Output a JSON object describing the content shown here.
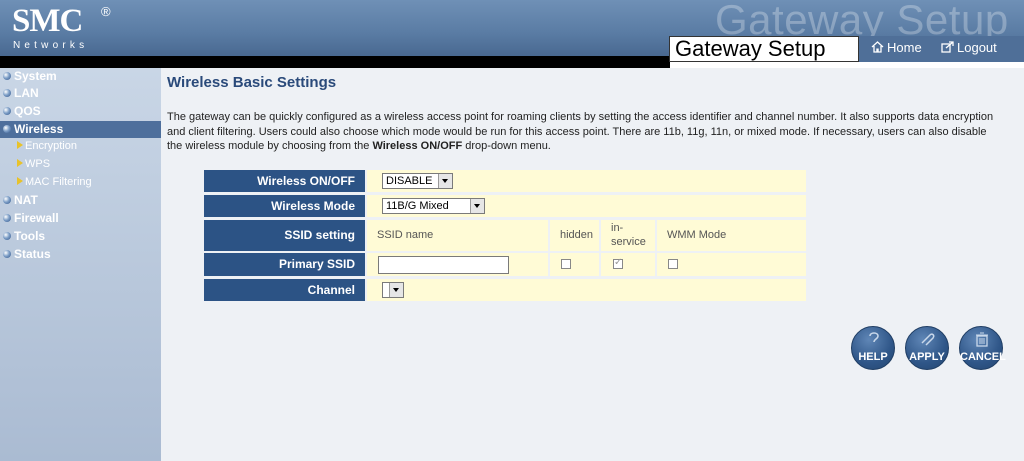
{
  "brand": {
    "name": "SMC",
    "reg": "®",
    "sub": "Networks",
    "watermark": "Gateway Setup"
  },
  "header": {
    "title": "Gateway Setup",
    "home": "Home",
    "logout": "Logout"
  },
  "sidebar": {
    "items": [
      {
        "label": "System"
      },
      {
        "label": "LAN"
      },
      {
        "label": "QOS"
      },
      {
        "label": "Wireless"
      },
      {
        "label": "NAT"
      },
      {
        "label": "Firewall"
      },
      {
        "label": "Tools"
      },
      {
        "label": "Status"
      }
    ],
    "subitems": [
      {
        "label": "Encryption"
      },
      {
        "label": "WPS"
      },
      {
        "label": "MAC Filtering"
      }
    ]
  },
  "main": {
    "title": "Wireless Basic Settings",
    "desc_part1": "The gateway can be quickly configured as a wireless access point for roaming clients by setting the access identifier and channel number. It also supports data encryption and client filtering. Users could also choose which mode would be run for this access point. There are 11b, 11g, 11n, or mixed mode. If necessary, users can also disable the wireless module by choosing from the ",
    "desc_bold": "Wireless ON/OFF",
    "desc_part2": " drop-down menu.",
    "form": {
      "wireless_onoff_label": "Wireless ON/OFF",
      "wireless_onoff_value": "DISABLE",
      "wireless_mode_label": "Wireless Mode",
      "wireless_mode_value": "11B/G Mixed",
      "ssid_setting_label": "SSID setting",
      "col_ssid_name": "SSID name",
      "col_hidden": "hidden",
      "col_inservice_1": "in-",
      "col_inservice_2": "service",
      "col_wmm": "WMM Mode",
      "primary_ssid_label": "Primary SSID",
      "primary_ssid_value": "",
      "hidden_checked": false,
      "inservice_checked": true,
      "wmm_checked": false,
      "channel_label": "Channel",
      "channel_value": ""
    },
    "buttons": {
      "help": "HELP",
      "apply": "APPLY",
      "cancel": "CANCEL"
    }
  },
  "colors": {
    "label_bg": "#2c5385",
    "value_bg": "#fffbd6",
    "sidebar_active": "#4e6f9c",
    "title": "#2a4a7a"
  }
}
